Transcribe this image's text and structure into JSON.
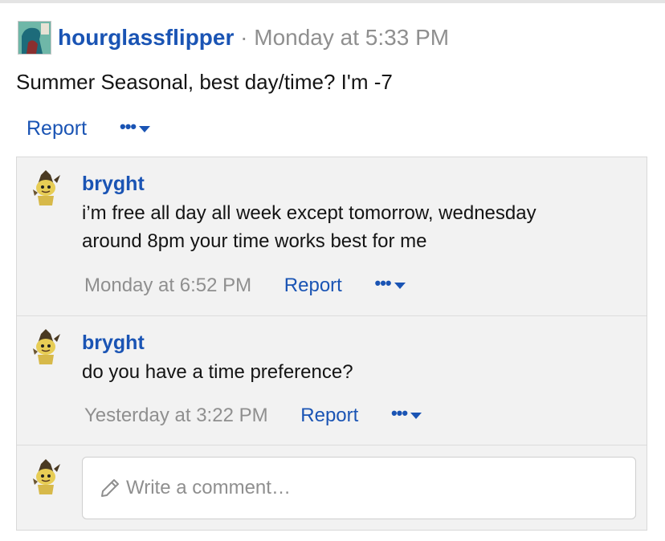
{
  "post": {
    "author": "hourglassflipper",
    "separator": "·",
    "time": "Monday at 5:33 PM",
    "body": "Summer Seasonal, best day/time? I'm -7",
    "report_label": "Report",
    "more_label": "•••"
  },
  "comments": [
    {
      "author": "bryght",
      "lines": [
        "i’m free all day all week except tomorrow, wednesday",
        "around 8pm your time works best for me"
      ],
      "time": "Monday at 6:52 PM",
      "report_label": "Report",
      "more_label": "•••"
    },
    {
      "author": "bryght",
      "lines": [
        "do you have a time preference?"
      ],
      "time": "Yesterday at 3:22 PM",
      "report_label": "Report",
      "more_label": "•••"
    }
  ],
  "compose": {
    "placeholder": "Write a comment…"
  },
  "colors": {
    "link": "#1a54b4",
    "muted": "#8f8f8f",
    "panel": "#f2f2f2"
  }
}
